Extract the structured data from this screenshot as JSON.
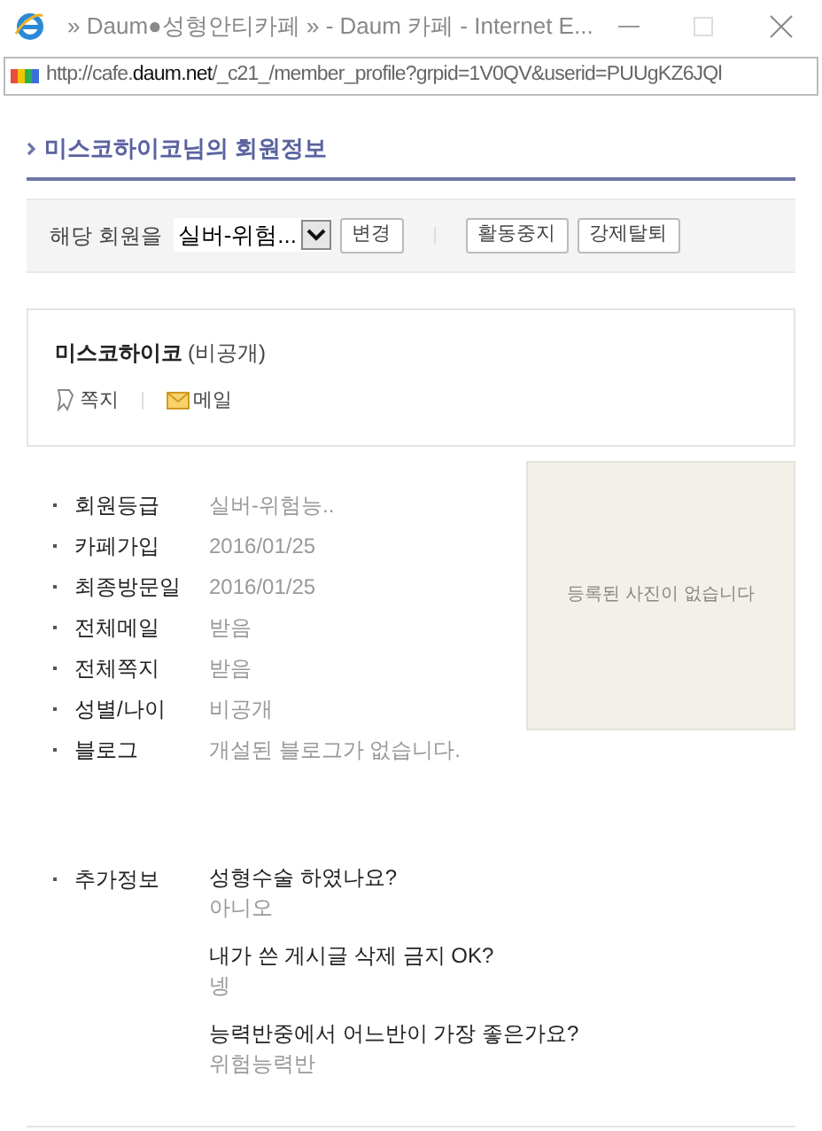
{
  "window": {
    "title": "» Daum●성형안티카페 » - Daum 카페 - Internet E...",
    "url": "http://cafe.**daum.net**/_c21_/member_profile?grpid=1V0QV&userid=PUUgKZ6JQl"
  },
  "heading": "미스코하이코님의 회원정보",
  "toolbar": {
    "label": "해당 회원을",
    "select_value": "실버-위험...",
    "change": "변경",
    "buttons": [
      "활동중지",
      "강제탈퇴"
    ]
  },
  "profile": {
    "nickname": "미스코하이코",
    "visibility": "(비공개)",
    "actions": [
      {
        "kind": "note",
        "label": "쪽지"
      },
      {
        "kind": "mail",
        "label": "메일"
      }
    ]
  },
  "info": [
    {
      "label": "회원등급",
      "value": "실버-위험능.."
    },
    {
      "label": "카페가입",
      "value": "2016/01/25"
    },
    {
      "label": "최종방문일",
      "value": "2016/01/25"
    },
    {
      "label": "전체메일",
      "value": "받음"
    },
    {
      "label": "전체쪽지",
      "value": "받음"
    },
    {
      "label": "성별/나이",
      "value": "비공개"
    },
    {
      "label": "블로그",
      "value": "개설된 블로그가 없습니다."
    }
  ],
  "photo": {
    "empty_text": "등록된 사진이 없습니다"
  },
  "extra": {
    "label": "추가정보",
    "items": [
      {
        "question": "성형수술 하였나요?",
        "answer": "아니오"
      },
      {
        "question": "내가 쓴 게시글 삭제 금지 OK?",
        "answer": "넹"
      },
      {
        "question": "능력반중에서 어느반이 가장 좋은가요?",
        "answer": "위험능력반"
      }
    ]
  }
}
